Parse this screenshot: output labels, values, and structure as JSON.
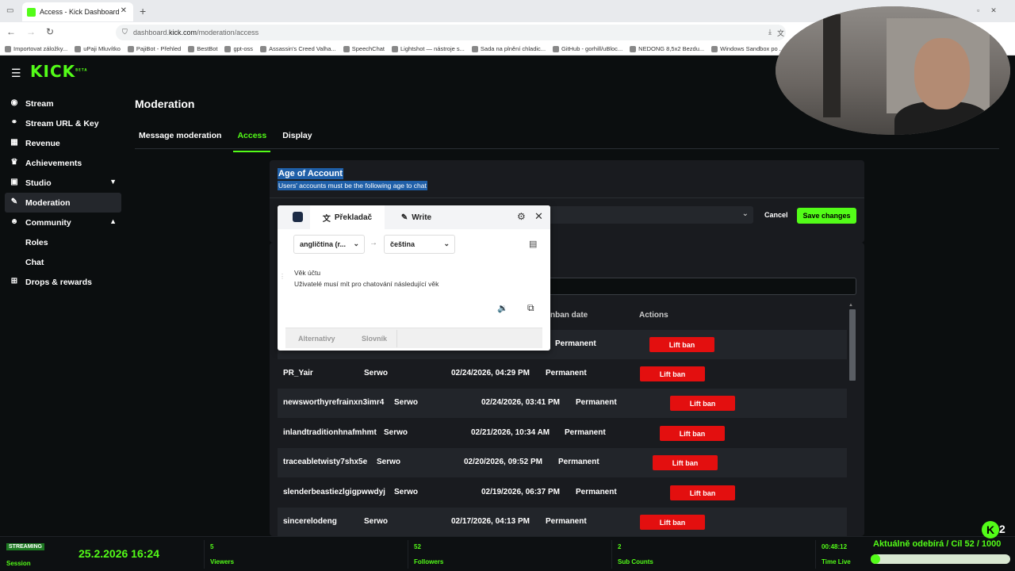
{
  "browser": {
    "tab_title": "Access - Kick Dashboard",
    "url_prefix": "dashboard.",
    "url_domain": "kick.com",
    "url_path": "/moderation/access",
    "bookmarks": [
      "Importovat záložky...",
      "uPaji Mluvítko",
      "PajiBot - Přehled",
      "BestBot",
      "gpt-oss",
      "Assassin's Creed Valha...",
      "SpeechChat",
      "Lightshot — nástroje s...",
      "Sada na plnění chladic...",
      "GitHub - gorhill/uBloc...",
      "NEDONG 8,5x2 Bezdu...",
      "Windows Sandbox po ..."
    ]
  },
  "app": {
    "logo": "KICK",
    "logo_badge": "BETA",
    "sidebar": [
      {
        "label": "Stream",
        "icon": "stream-icon"
      },
      {
        "label": "Stream URL & Key",
        "icon": "link-icon"
      },
      {
        "label": "Revenue",
        "icon": "revenue-icon"
      },
      {
        "label": "Achievements",
        "icon": "trophy-icon"
      },
      {
        "label": "Studio",
        "icon": "studio-icon"
      },
      {
        "label": "Moderation",
        "icon": "wrench-icon"
      },
      {
        "label": "Community",
        "icon": "community-icon"
      },
      {
        "label": "Roles",
        "icon": ""
      },
      {
        "label": "Chat",
        "icon": ""
      },
      {
        "label": "Drops & rewards",
        "icon": "gift-icon"
      }
    ],
    "page_title": "Moderation",
    "tabs": [
      "Message moderation",
      "Access",
      "Display"
    ],
    "active_tab": "Access",
    "age_card": {
      "title": "Age of Account",
      "subtitle": "Users' accounts must be the following age to chat",
      "cancel_label": "Cancel",
      "save_label": "Save changes"
    },
    "ban_table": {
      "headers": {
        "unban_date": "nban date",
        "actions": "Actions"
      },
      "first_row_duration": "Permanent",
      "first_row_action": "Lift ban",
      "rows": [
        {
          "username": "PR_Yair",
          "moderator": "Serwo",
          "date": "02/24/2026, 04:29 PM",
          "duration": "Permanent",
          "action": "Lift ban"
        },
        {
          "username": "newsworthyrefrainxn3imr4",
          "moderator": "Serwo",
          "date": "02/24/2026, 03:41 PM",
          "duration": "Permanent",
          "action": "Lift ban"
        },
        {
          "username": "inlandtraditionhnafmhmt",
          "moderator": "Serwo",
          "date": "02/21/2026, 10:34 AM",
          "duration": "Permanent",
          "action": "Lift ban"
        },
        {
          "username": "traceabletwisty7shx5e",
          "moderator": "Serwo",
          "date": "02/20/2026, 09:52 PM",
          "duration": "Permanent",
          "action": "Lift ban"
        },
        {
          "username": "slenderbeastiezlgigpwwdyj",
          "moderator": "Serwo",
          "date": "02/19/2026, 06:37 PM",
          "duration": "Permanent",
          "action": "Lift ban"
        },
        {
          "username": "sincerelodeng",
          "moderator": "Serwo",
          "date": "02/17/2026, 04:13 PM",
          "duration": "Permanent",
          "action": "Lift ban"
        }
      ]
    }
  },
  "translator": {
    "tab_translate": "Překladač",
    "tab_write": "Write",
    "source_lang": "angličtina (r...",
    "target_lang": "čeština",
    "line1": "Věk účtu",
    "line2": "Uživatelé musí mít pro chatování následující věk",
    "alternatives": "Alternativy",
    "dictionary": "Slovník"
  },
  "statusbar": {
    "badge": "STREAMING",
    "session_label": "Session",
    "session_time": "25.2.2026 16:24",
    "viewers_value": "5",
    "viewers_label": "Viewers",
    "followers_value": "52",
    "followers_label": "Followers",
    "subs_value": "2",
    "subs_label": "Sub Counts",
    "live_value": "00:48:12",
    "live_label": "Time Live",
    "subgoal_text": "Aktuálně odebírá / Cíl   52 / 1000",
    "subgoal_fraction": 0.052,
    "kick_badge_count": "2"
  }
}
